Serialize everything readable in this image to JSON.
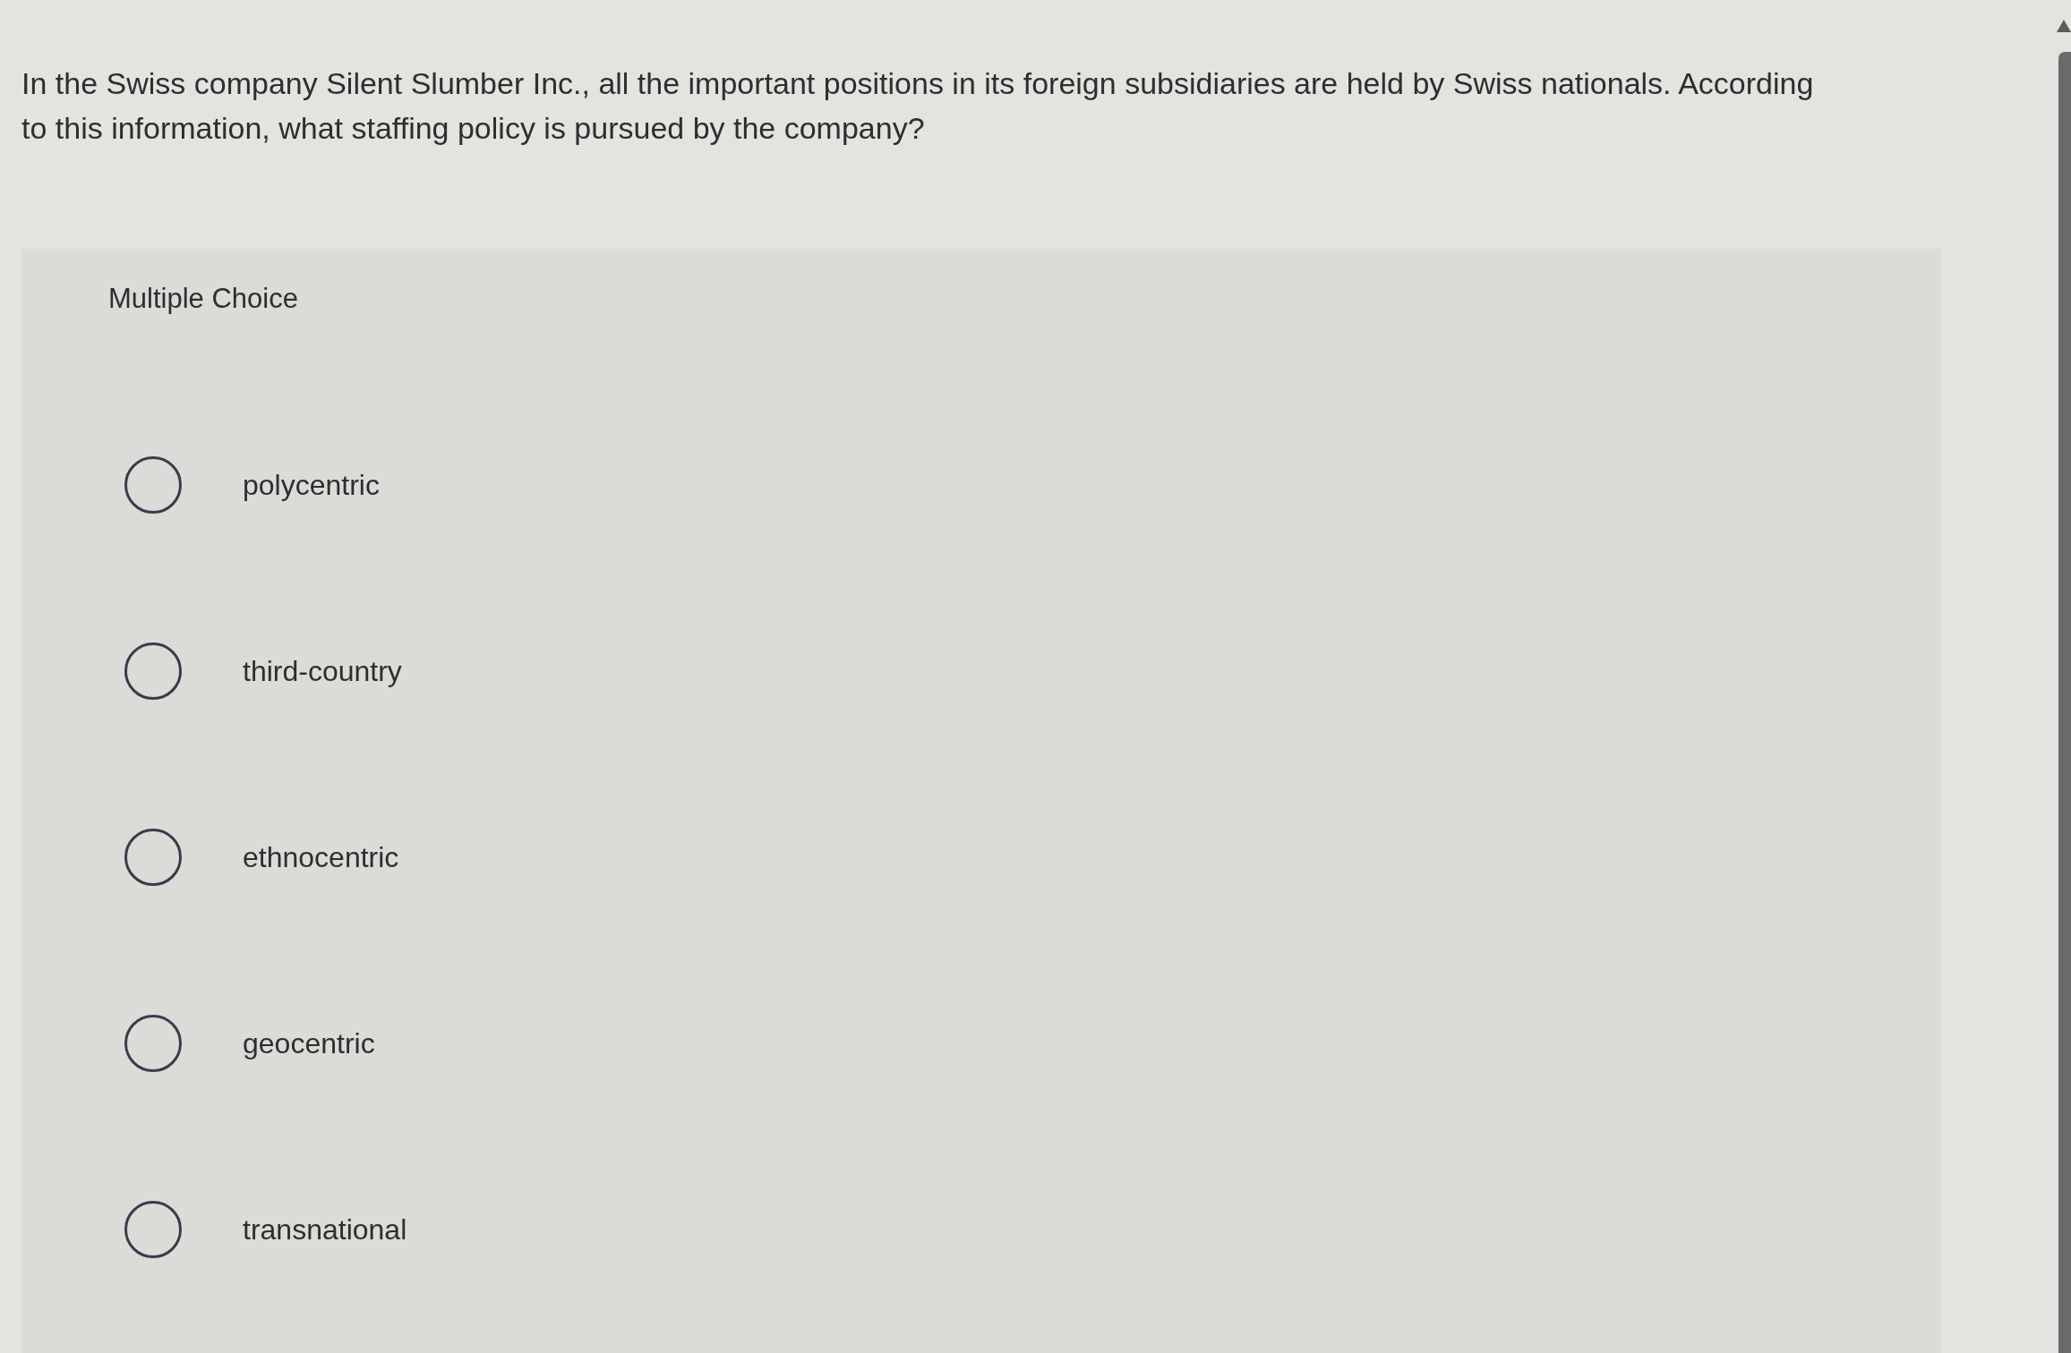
{
  "question": "In the Swiss company Silent Slumber Inc., all the important positions in its foreign subsidiaries are held by Swiss nationals. According to this information, what staffing policy is pursued by the company?",
  "answer_panel": {
    "label": "Multiple Choice",
    "options": [
      {
        "label": "polycentric",
        "selected": false
      },
      {
        "label": "third-country",
        "selected": false
      },
      {
        "label": "ethnocentric",
        "selected": false
      },
      {
        "label": "geocentric",
        "selected": false
      },
      {
        "label": "transnational",
        "selected": false
      }
    ]
  }
}
